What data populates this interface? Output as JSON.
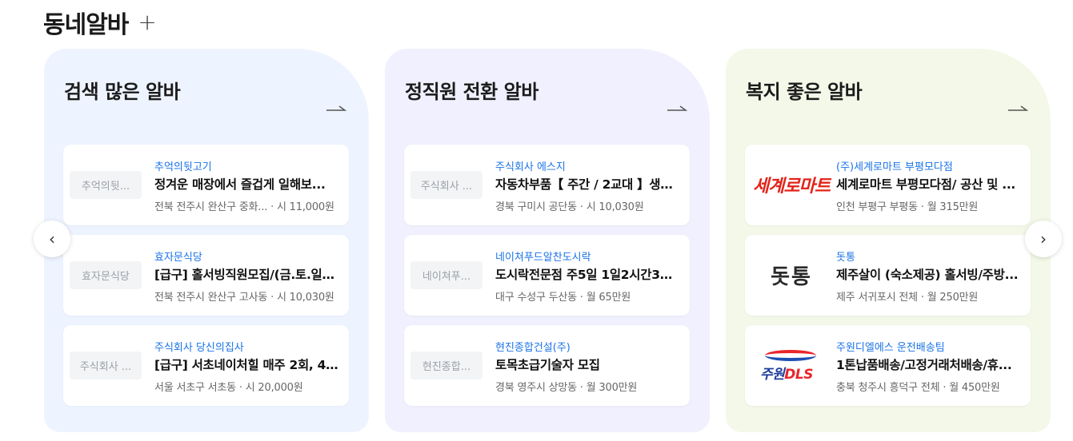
{
  "header": {
    "title": "동네알바",
    "plus": "+"
  },
  "nav": {
    "prev": "‹",
    "next": "›"
  },
  "panels": [
    {
      "title": "검색 많은 알바",
      "arrow_icon": "long-right-arrow-icon",
      "cards": [
        {
          "logo_text": "추억의뒷...",
          "company": "추억의뒷고기",
          "title": "정겨운 매장에서 즐겁게 일해보...",
          "meta": "전북 전주시 완산구 중화... · 시 11,000원"
        },
        {
          "logo_text": "효자문식당",
          "company": "효자문식당",
          "title": "[급구] 홀서빙직원모집/(금.토.일)...",
          "meta": "전북 전주시 완산구 고사동 · 시 10,030원"
        },
        {
          "logo_text": "주식회사 ...",
          "company": "주식회사 당신의집사",
          "title": "[급구] 서초네이처힐 매주 2회, 4...",
          "meta": "서울 서초구 서초동 · 시 20,000원"
        }
      ]
    },
    {
      "title": "정직원 전환 알바",
      "arrow_icon": "long-right-arrow-icon",
      "cards": [
        {
          "logo_text": "주식회사 ...",
          "company": "주식회사 에스지",
          "title": "자동차부품【 주간 / 2교대 】생산...",
          "meta": "경북 구미시 공단동 · 시 10,030원"
        },
        {
          "logo_text": "네이쳐푸...",
          "company": "네이쳐푸드알찬도시락",
          "title": "도시락전문점 주5일 1일2시간30...",
          "meta": "대구 수성구 두산동 · 월 65만원"
        },
        {
          "logo_text": "현진종합...",
          "company": "현진종합건설(주)",
          "title": "토목초급기술자 모집",
          "meta": "경북 영주시 상망동 · 월 300만원"
        }
      ]
    },
    {
      "title": "복지 좋은 알바",
      "arrow_icon": "long-right-arrow-icon",
      "cards": [
        {
          "logo_text": "세계로마트",
          "company": "(주)세계로마트 부평모다점",
          "title": "세계로마트 부평모다점/ 공산 및 ...",
          "meta": "인천 부평구 부평동 · 월 315만원"
        },
        {
          "logo_text": "돗통",
          "company": "돗통",
          "title": "제주살이 (숙소제공) 홀서빙/주방...",
          "meta": "제주 서귀포시 전체 · 월 250만원"
        },
        {
          "logo_text": "주원DLS",
          "logo_text_a": "주원",
          "logo_text_b": "DLS",
          "company": "주원디엘에스 운전배송팀",
          "title": "1톤납품배송/고정거래처배송/휴...",
          "meta": "충북 청주시 흥덕구 전체 · 월 450만원"
        }
      ]
    }
  ]
}
